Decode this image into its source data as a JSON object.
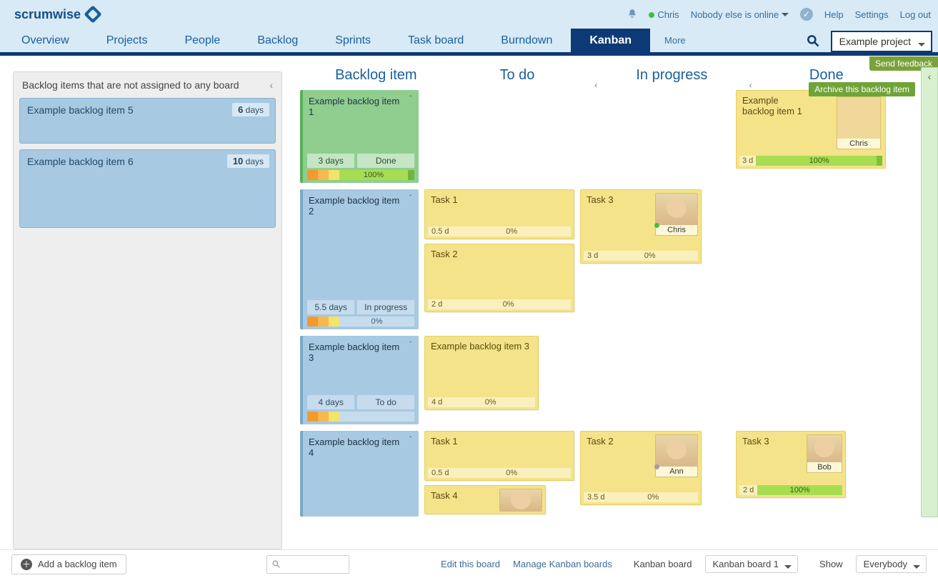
{
  "brand": "scrumwise",
  "topbar": {
    "user": "Chris",
    "online_status": "Nobody else is online",
    "help": "Help",
    "settings": "Settings",
    "logout": "Log out"
  },
  "nav": {
    "overview": "Overview",
    "projects": "Projects",
    "people": "People",
    "backlog": "Backlog",
    "sprints": "Sprints",
    "taskboard": "Task board",
    "burndown": "Burndown",
    "kanban": "Kanban",
    "more": "More",
    "project_select": "Example project"
  },
  "feedback": "Send feedback",
  "sidebar": {
    "title": "Backlog items that are not assigned to any board",
    "items": [
      {
        "title": "Example backlog item 5",
        "est_num": "6",
        "est_unit": "days"
      },
      {
        "title": "Example backlog item 6",
        "est_num": "10",
        "est_unit": "days"
      }
    ]
  },
  "columns": {
    "backlog": "Backlog item",
    "todo": "To do",
    "inprogress": "In progress",
    "done": "Done"
  },
  "rows": [
    {
      "backlog": {
        "title": "Example backlog item 1",
        "est": "3 days",
        "status": "Done",
        "progress": "100%",
        "green": true
      },
      "done": {
        "title": "Example backlog item 1",
        "assignee": "Chris",
        "dur": "3 d",
        "progress": "100%",
        "archive_tip": "Archive this backlog item"
      }
    },
    {
      "backlog": {
        "title": "Example backlog item 2",
        "est": "5.5 days",
        "status": "In progress",
        "progress": "0%"
      },
      "todo": [
        {
          "title": "Task 1",
          "dur": "0.5 d",
          "progress": "0%"
        },
        {
          "title": "Task 2",
          "dur": "2 d",
          "progress": "0%"
        }
      ],
      "inprogress": [
        {
          "title": "Task 3",
          "assignee": "Chris",
          "dur": "3 d",
          "progress": "0%"
        }
      ]
    },
    {
      "backlog": {
        "title": "Example backlog item 3",
        "est": "4 days",
        "status": "To do",
        "progress": ""
      },
      "todo": [
        {
          "title": "Example backlog item 3",
          "dur": "4 d",
          "progress": "0%"
        }
      ]
    },
    {
      "backlog": {
        "title": "Example backlog item 4"
      },
      "todo": [
        {
          "title": "Task 1",
          "dur": "0.5 d",
          "progress": "0%"
        },
        {
          "title": "Task 4"
        }
      ],
      "inprogress": [
        {
          "title": "Task 2",
          "assignee": "Ann",
          "dur": "3.5 d",
          "progress": "0%"
        }
      ],
      "doneTasks": [
        {
          "title": "Task 3",
          "assignee": "Bob",
          "dur": "2 d",
          "progress": "100%"
        }
      ]
    }
  ],
  "bottom": {
    "add": "Add a backlog item",
    "edit": "Edit this board",
    "manage": "Manage Kanban boards",
    "board_label": "Kanban board",
    "board_select": "Kanban board 1",
    "show_label": "Show",
    "show_select": "Everybody"
  }
}
